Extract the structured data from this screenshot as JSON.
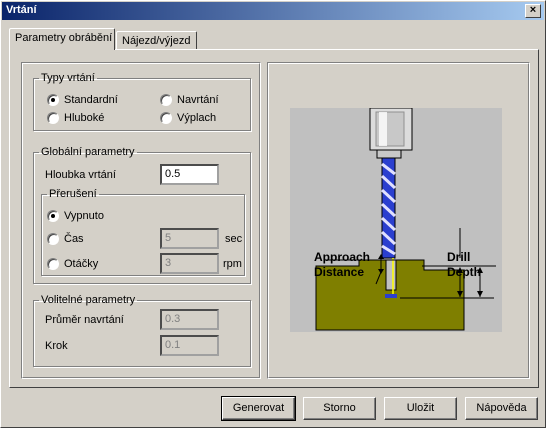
{
  "window": {
    "title": "Vrtání",
    "close_glyph": "×"
  },
  "tabs": [
    {
      "label": "Parametry obrábění",
      "active": true
    },
    {
      "label": "Nájezd/výjezd",
      "active": false
    }
  ],
  "drill_types": {
    "legend": "Typy vrtání",
    "options": [
      {
        "label": "Standardní",
        "selected": true
      },
      {
        "label": "Navrtání",
        "selected": false
      },
      {
        "label": "Hluboké",
        "selected": false
      },
      {
        "label": "Výplach",
        "selected": false
      }
    ]
  },
  "global_params": {
    "legend": "Globální parametry",
    "depth_label": "Hloubka vrtání",
    "depth_value": "0.5",
    "interrupt": {
      "legend": "Přerušení",
      "off_label": "Vypnuto",
      "time_label": "Čas",
      "time_value": "5",
      "time_unit": "sec",
      "rev_label": "Otáčky",
      "rev_value": "3",
      "rev_unit": "rpm"
    }
  },
  "optional_params": {
    "legend": "Volitelné parametry",
    "predrill_diameter_label": "Průměr navrtání",
    "predrill_diameter_value": "0.3",
    "step_label": "Krok",
    "step_value": "0.1"
  },
  "diagram": {
    "approach_line1": "Approach",
    "approach_line2": "Distance",
    "depth_line1": "Drill",
    "depth_line2": "Depth",
    "colors": {
      "background": "#c0c0c0",
      "workpiece": "#7f7f00",
      "drill": "#2b3fcf",
      "approach_line": "#ffff00"
    }
  },
  "buttons": {
    "generate": "Generovat",
    "cancel": "Storno",
    "save": "Uložit",
    "help": "Nápověda"
  }
}
